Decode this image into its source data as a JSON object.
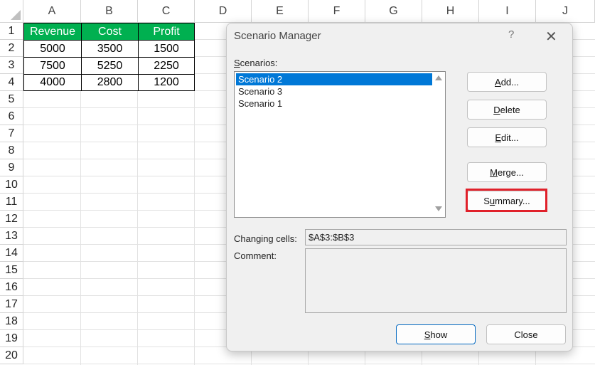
{
  "sheet": {
    "columns": [
      "A",
      "B",
      "C",
      "D",
      "E",
      "F",
      "G",
      "H",
      "I",
      "J"
    ],
    "rows": [
      "1",
      "2",
      "3",
      "4",
      "5",
      "6",
      "7",
      "8",
      "9",
      "10",
      "11",
      "12",
      "13",
      "14",
      "15",
      "16",
      "17",
      "18",
      "19",
      "20"
    ],
    "table": {
      "headers": [
        "Revenue",
        "Cost",
        "Profit"
      ],
      "rows": [
        [
          "5000",
          "3500",
          "1500"
        ],
        [
          "7500",
          "5250",
          "2250"
        ],
        [
          "4000",
          "2800",
          "1200"
        ]
      ],
      "header_color": "#00b050"
    }
  },
  "dialog": {
    "title": "Scenario Manager",
    "help": "?",
    "close": "✕",
    "scenarios_label_u": "S",
    "scenarios_label_rest": "cenarios:",
    "scenarios": [
      "Scenario 2",
      "Scenario 3",
      "Scenario 1"
    ],
    "selected_index": 0,
    "buttons": {
      "add_u": "A",
      "add_rest": "dd...",
      "delete_u": "D",
      "delete_rest": "elete",
      "edit_u": "E",
      "edit_rest": "dit...",
      "merge_u": "M",
      "merge_rest": "erge...",
      "summary_pre": "S",
      "summary_u": "u",
      "summary_rest": "mmary...",
      "show_u": "S",
      "show_rest": "how",
      "close": "Close"
    },
    "changing_cells_label": "Changing cells:",
    "changing_cells_value": "$A$3:$B$3",
    "comment_label": "Comment:",
    "comment_value": "",
    "highlight_color": "#e0202a"
  }
}
